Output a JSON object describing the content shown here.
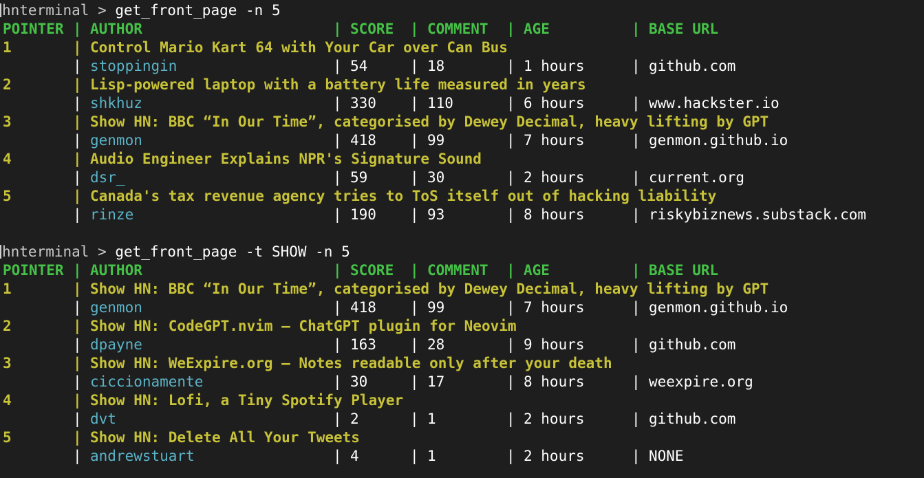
{
  "prompt_label": "hnterminal > ",
  "separator": "|",
  "header": {
    "pointer": "POINTER",
    "author": "AUTHOR",
    "score": "SCORE",
    "comment": "COMMENT",
    "age": "AGE",
    "base_url": "BASE URL"
  },
  "sessions": [
    {
      "command": "get_front_page -n 5",
      "rows": [
        {
          "pointer": "1",
          "title": "Control Mario Kart 64 with Your Car over Can Bus",
          "author": "stoppingin",
          "score": "54",
          "comment": "18",
          "age": "1 hours",
          "base_url": "github.com"
        },
        {
          "pointer": "2",
          "title": "Lisp-powered laptop with a battery life measured in years",
          "author": "shkhuz",
          "score": "330",
          "comment": "110",
          "age": "6 hours",
          "base_url": "www.hackster.io"
        },
        {
          "pointer": "3",
          "title": "Show HN: BBC “In Our Time”, categorised by Dewey Decimal, heavy lifting by GPT",
          "author": "genmon",
          "score": "418",
          "comment": "99",
          "age": "7 hours",
          "base_url": "genmon.github.io"
        },
        {
          "pointer": "4",
          "title": "Audio Engineer Explains NPR's Signature Sound",
          "author": "dsr_",
          "score": "59",
          "comment": "30",
          "age": "2 hours",
          "base_url": "current.org"
        },
        {
          "pointer": "5",
          "title": "Canada's tax revenue agency tries to ToS itself out of hacking liability",
          "author": "rinze",
          "score": "190",
          "comment": "93",
          "age": "8 hours",
          "base_url": "riskybiznews.substack.com"
        }
      ]
    },
    {
      "command": "get_front_page -t SHOW -n 5",
      "rows": [
        {
          "pointer": "1",
          "title": "Show HN: BBC “In Our Time”, categorised by Dewey Decimal, heavy lifting by GPT",
          "author": "genmon",
          "score": "418",
          "comment": "99",
          "age": "7 hours",
          "base_url": "genmon.github.io"
        },
        {
          "pointer": "2",
          "title": "Show HN: CodeGPT.nvim – ChatGPT plugin for Neovim",
          "author": "dpayne",
          "score": "163",
          "comment": "28",
          "age": "9 hours",
          "base_url": "github.com"
        },
        {
          "pointer": "3",
          "title": "Show HN: WeExpire.org – Notes readable only after your death",
          "author": "ciccionamente",
          "score": "30",
          "comment": "17",
          "age": "8 hours",
          "base_url": "weexpire.org"
        },
        {
          "pointer": "4",
          "title": "Show HN: Lofi, a Tiny Spotify Player",
          "author": "dvt",
          "score": "2",
          "comment": "1",
          "age": "2 hours",
          "base_url": "github.com"
        },
        {
          "pointer": "5",
          "title": "Show HN: Delete All Your Tweets",
          "author": "andrewstuart",
          "score": "4",
          "comment": "1",
          "age": "2 hours",
          "base_url": "NONE"
        }
      ]
    }
  ],
  "colors": {
    "background": "#1e1e1e",
    "header_green": "#45c147",
    "title_yellow": "#c7c238",
    "author_cyan": "#5ab4c8",
    "text_white": "#ffffff"
  }
}
